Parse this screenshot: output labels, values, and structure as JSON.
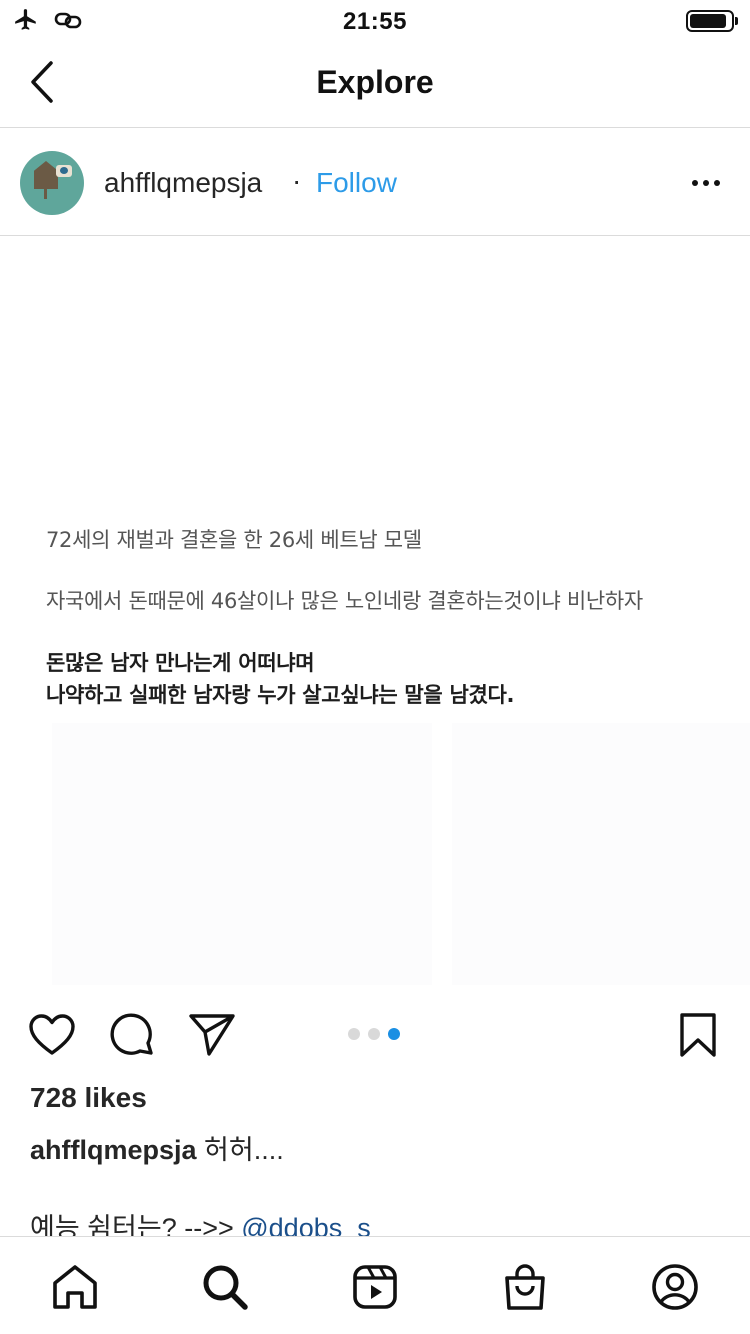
{
  "status_bar": {
    "time": "21:55",
    "battery_level_percent": 90,
    "icons": [
      "airplane-icon",
      "link-icon"
    ]
  },
  "nav": {
    "title": "Explore",
    "back_icon": "chevron-left-icon"
  },
  "post": {
    "username": "ahfflqmepsja",
    "separator": "·",
    "follow_label": "Follow",
    "more_icon": "more-horizontal-icon",
    "image_text": {
      "line1": "72세의 재벌과 결혼을 한 26세 베트남 모델",
      "line2": "자국에서 돈때문에 46살이나 많은 노인네랑 결혼하는것이냐 비난하자",
      "line3": "돈많은 남자 만나는게 어떠냐며",
      "line4": "나약하고 실패한 남자랑 누가 살고싶냐는 말을 남겼다."
    },
    "carousel": {
      "count": 3,
      "active_index": 2
    },
    "likes": "728 likes",
    "caption_user": "ahfflqmepsja",
    "caption_text": " 허허....",
    "caption_line2": "예능 쉼터는? -->> ",
    "mention": "@ddobs_s"
  },
  "tabs": [
    {
      "icon": "home-icon"
    },
    {
      "icon": "search-icon",
      "active": true
    },
    {
      "icon": "reels-icon"
    },
    {
      "icon": "shop-icon"
    },
    {
      "icon": "profile-icon"
    }
  ],
  "colors": {
    "link_blue": "#2d9be8",
    "dot_active": "#1a8fe3",
    "mention": "#1b4f8a",
    "divider": "#dbdbdb"
  }
}
